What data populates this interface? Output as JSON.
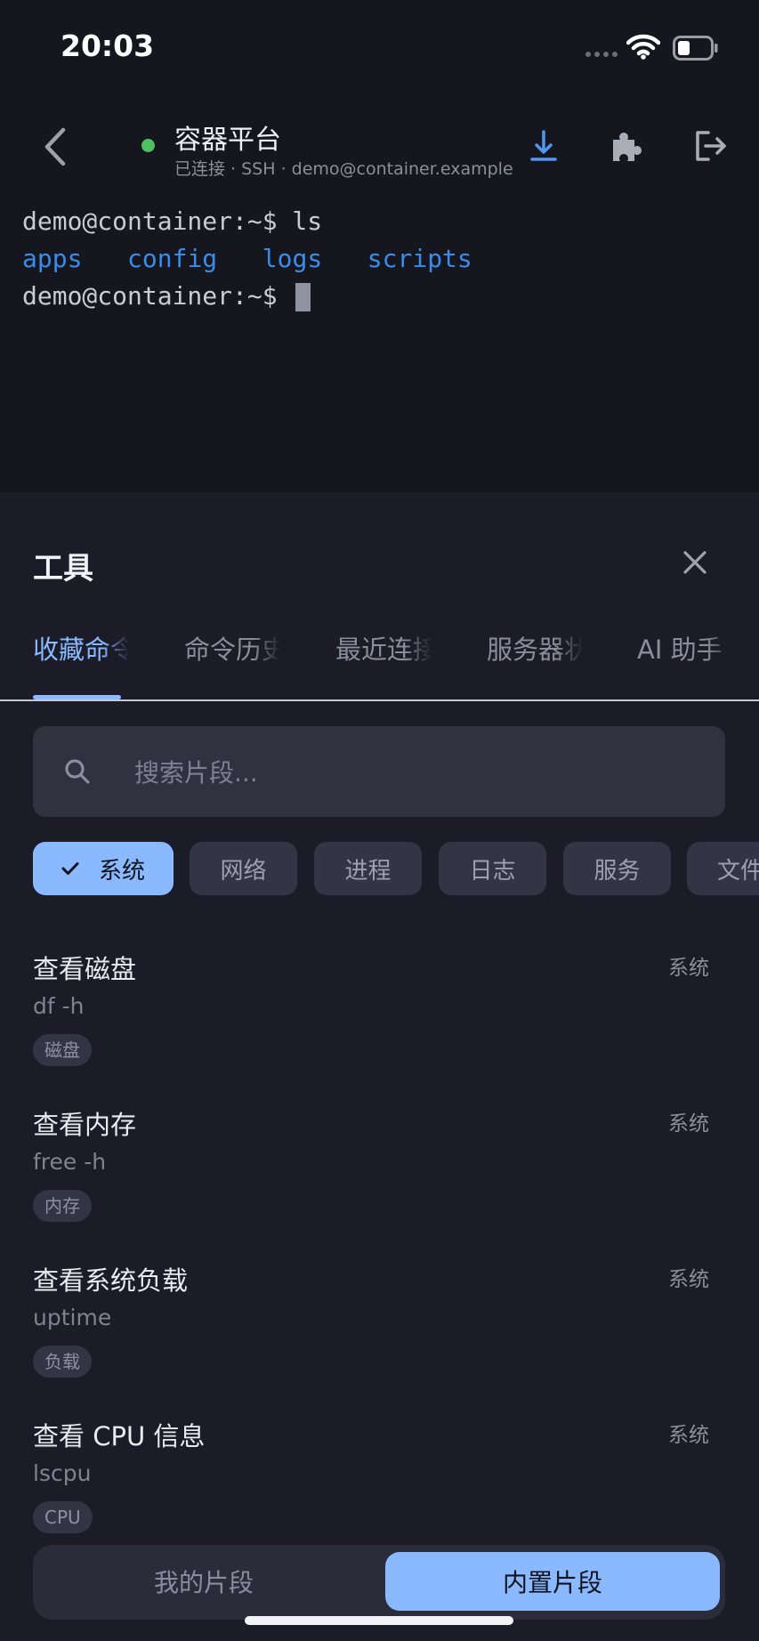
{
  "status_bar": {
    "time": "20:03"
  },
  "header": {
    "title": "容器平台",
    "subtitle": "已连接 · SSH · demo@container.example",
    "connection_color": "#4fbf63"
  },
  "terminal": {
    "prompt": "demo@container:~$",
    "line1_cmd": " ls",
    "dirs": [
      "apps",
      "config",
      "logs",
      "scripts"
    ]
  },
  "sheet": {
    "title": "工具",
    "tabs": [
      {
        "label": "收藏命令"
      },
      {
        "label": "命令历史"
      },
      {
        "label": "最近连接"
      },
      {
        "label": "服务器状态"
      },
      {
        "label": "AI 助手"
      }
    ],
    "search_placeholder": "搜索片段...",
    "chips": [
      {
        "label": "系统",
        "selected": true
      },
      {
        "label": "网络"
      },
      {
        "label": "进程"
      },
      {
        "label": "日志"
      },
      {
        "label": "服务"
      },
      {
        "label": "文件"
      }
    ],
    "snippets": [
      {
        "title": "查看磁盘",
        "command": "df -h",
        "category": "系统",
        "tag": "磁盘"
      },
      {
        "title": "查看内存",
        "command": "free -h",
        "category": "系统",
        "tag": "内存"
      },
      {
        "title": "查看系统负载",
        "command": "uptime",
        "category": "系统",
        "tag": "负载"
      },
      {
        "title": "查看 CPU 信息",
        "command": "lscpu",
        "category": "系统",
        "tag": "CPU"
      }
    ],
    "segments": {
      "left": "我的片段",
      "right": "内置片段"
    }
  },
  "colors": {
    "accent": "#8ab9ff",
    "dir": "#3a8bea",
    "background": "#1b1c27"
  }
}
